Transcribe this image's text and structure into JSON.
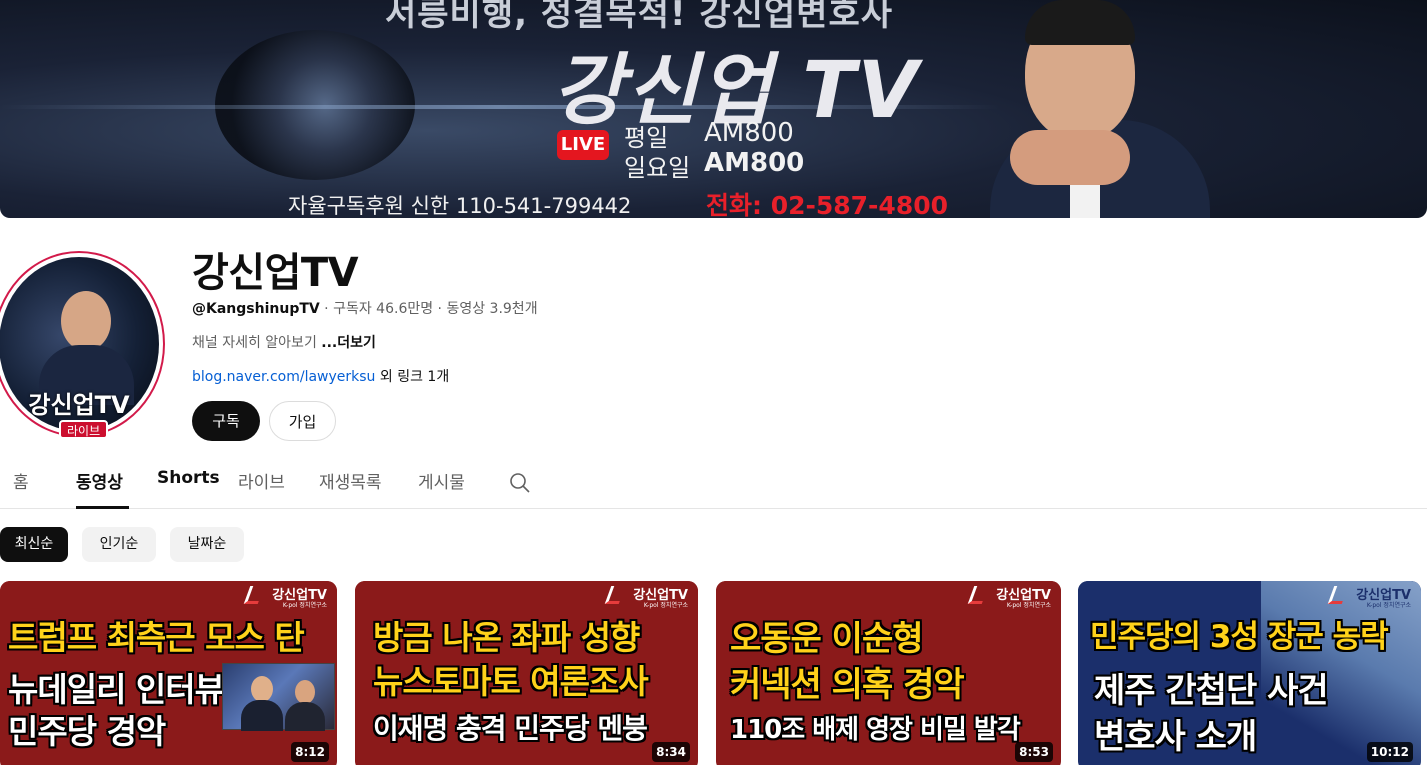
{
  "banner": {
    "tagline": "서릉비행, 정결목적! 강신업변호사",
    "title": "강신업 TV",
    "live_label": "LIVE",
    "schedule": [
      {
        "day": "평일",
        "time": "AM800"
      },
      {
        "day": "일요일",
        "time": "AM800"
      }
    ],
    "sponsor": "자율구독후원 신한 110-541-799442",
    "phone": "전화: 02-587-4800"
  },
  "channel": {
    "avatar_text": "강신업TV",
    "live_badge": "라이브",
    "name": "강신업TV",
    "handle": "@KangshinupTV",
    "stats": " · 구독자 46.6만명 · 동영상 3.9천개",
    "description": "채널 자세히 알아보기 ",
    "more_label": "...더보기",
    "link": "blog.naver.com/lawyerksu",
    "extra_links": " 외 링크 1개",
    "subscribe_label": "구독",
    "join_label": "가입"
  },
  "tabs": [
    {
      "label": "홈"
    },
    {
      "label": "동영상"
    },
    {
      "label": "Shorts"
    },
    {
      "label": "라이브"
    },
    {
      "label": "재생목록"
    },
    {
      "label": "게시물"
    }
  ],
  "active_tab": "동영상",
  "chips": [
    {
      "label": "최신순"
    },
    {
      "label": "인기순"
    },
    {
      "label": "날짜순"
    }
  ],
  "active_chip": "최신순",
  "videos": [
    {
      "logo": "강신업TV",
      "logo_sub": "K-pol 정치연구소",
      "lines": [
        "트럼프 최측근 모스 탄",
        "뉴데일리 인터뷰",
        "민주당 경악"
      ],
      "duration": "8:12"
    },
    {
      "logo": "강신업TV",
      "logo_sub": "K-pol 정치연구소",
      "lines": [
        "방금 나온 좌파 성향",
        "뉴스토마토 여론조사",
        "이재명 충격 민주당 멘붕"
      ],
      "duration": "8:34"
    },
    {
      "logo": "강신업TV",
      "logo_sub": "K-pol 정치연구소",
      "lines": [
        "오동운 이순형",
        "커넥션 의혹 경악",
        "110조 배제 영장 비밀 발각"
      ],
      "duration": "8:53"
    },
    {
      "logo": "강신업TV",
      "logo_sub": "K-pol 정치연구소",
      "lines": [
        "민주당의 3성 장군 농락",
        "제주 간첩단 사건",
        "변호사 소개"
      ],
      "duration": "10:12"
    }
  ],
  "colors": {
    "accent_red": "#cc0f2f",
    "link_blue": "#065fd4",
    "thumb_red": "#8b1a1a",
    "thumb_blue": "#1b2f6b",
    "headline_yellow": "#ffd21a"
  }
}
